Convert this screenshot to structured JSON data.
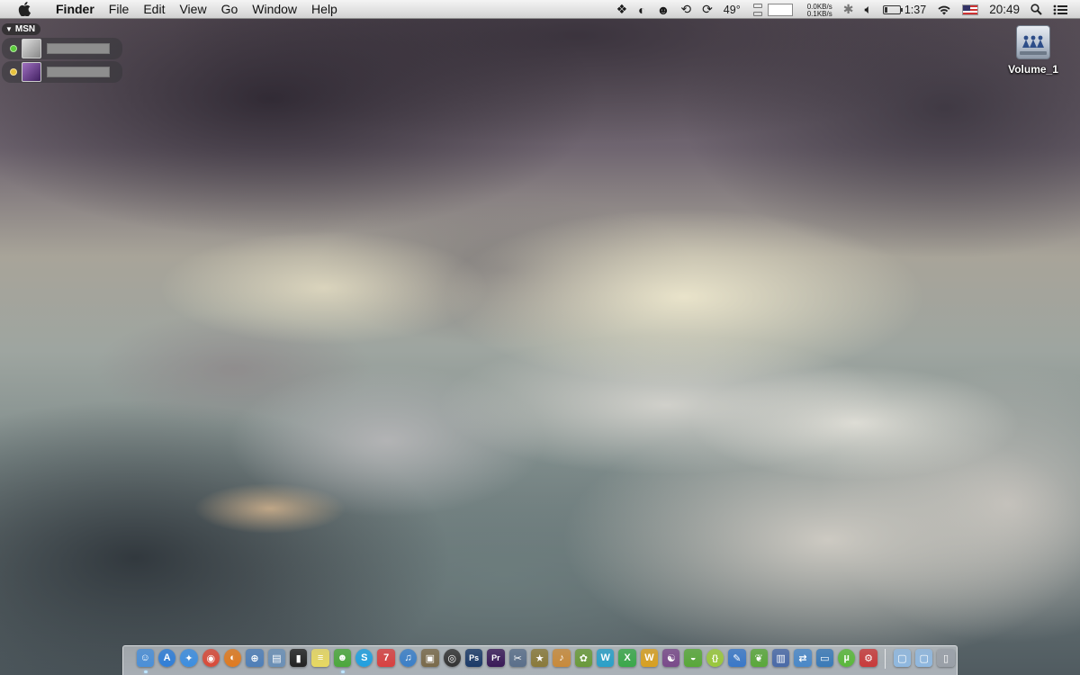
{
  "menubar": {
    "app_name": "Finder",
    "menus": [
      "File",
      "Edit",
      "View",
      "Go",
      "Window",
      "Help"
    ],
    "status": {
      "temperature": "49°",
      "net_down": "0.0KB/s",
      "net_up": "0.1KB/s",
      "battery_time": "1:37",
      "clock": "20:49"
    }
  },
  "msn": {
    "title": "MSN",
    "contacts": [
      {
        "status_color": "#5ccc3c"
      },
      {
        "status_color": "#e9c23c"
      }
    ]
  },
  "desktop": {
    "volume_label": "Volume_1"
  },
  "dock": {
    "apps": [
      {
        "icon": "finder-icon",
        "glyph": "☺",
        "color": "#4a8fd8",
        "running": true
      },
      {
        "icon": "app-store-icon",
        "glyph": "A",
        "color": "#2f7ed8",
        "running": false
      },
      {
        "icon": "safari-icon",
        "glyph": "✦",
        "color": "#3c8ee0",
        "running": false
      },
      {
        "icon": "chrome-icon",
        "glyph": "◉",
        "color": "#d94a38",
        "running": false
      },
      {
        "icon": "firefox-icon",
        "glyph": "◐",
        "color": "#e07a1e",
        "running": false
      },
      {
        "icon": "network-utility-icon",
        "glyph": "⊕",
        "color": "#4f7fb8",
        "running": false
      },
      {
        "icon": "preview-icon",
        "glyph": "▤",
        "color": "#6a8fb6",
        "running": false
      },
      {
        "icon": "terminal-icon",
        "glyph": "▮",
        "color": "#222222",
        "running": false
      },
      {
        "icon": "stickies-icon",
        "glyph": "≡",
        "color": "#e8d860",
        "running": false
      },
      {
        "icon": "adium-icon",
        "glyph": "☻",
        "color": "#4ca83c",
        "running": true
      },
      {
        "icon": "skype-icon",
        "glyph": "S",
        "color": "#1fa0e0",
        "running": false
      },
      {
        "icon": "ical-icon",
        "glyph": "7",
        "color": "#d84040",
        "running": false
      },
      {
        "icon": "itunes-icon",
        "glyph": "♫",
        "color": "#3a7fc8",
        "running": false
      },
      {
        "icon": "iphoto-icon",
        "glyph": "▣",
        "color": "#7a6a4a",
        "running": false
      },
      {
        "icon": "aperture-icon",
        "glyph": "◎",
        "color": "#333333",
        "running": false
      },
      {
        "icon": "photoshop-icon",
        "glyph": "Ps",
        "color": "#1b3a68",
        "running": false
      },
      {
        "icon": "premiere-icon",
        "glyph": "Pr",
        "color": "#3a1a58",
        "running": false
      },
      {
        "icon": "final-cut-icon",
        "glyph": "✂",
        "color": "#5a6f8a",
        "running": false
      },
      {
        "icon": "imovie-icon",
        "glyph": "★",
        "color": "#8a7a3a",
        "running": false
      },
      {
        "icon": "garageband-icon",
        "glyph": "♪",
        "color": "#c88a3a",
        "running": false
      },
      {
        "icon": "monkey-game-icon",
        "glyph": "✿",
        "color": "#6a9a3a",
        "running": false
      },
      {
        "icon": "word-icon",
        "glyph": "W",
        "color": "#2aa0c8",
        "running": false
      },
      {
        "icon": "excel-icon",
        "glyph": "X",
        "color": "#3aa84a",
        "running": false
      },
      {
        "icon": "powerpoint-icon",
        "glyph": "W",
        "color": "#d8a020",
        "running": false
      },
      {
        "icon": "widget-icon",
        "glyph": "☯",
        "color": "#7a4a8a",
        "running": false
      },
      {
        "icon": "android-icon",
        "glyph": "◒",
        "color": "#58a838",
        "running": false
      },
      {
        "icon": "coda-icon",
        "glyph": "{}",
        "color": "#9ac83a",
        "running": false
      },
      {
        "icon": "xcode-icon",
        "glyph": "✎",
        "color": "#3a78c8",
        "running": false
      },
      {
        "icon": "evernote-icon",
        "glyph": "❦",
        "color": "#5aa83a",
        "running": false
      },
      {
        "icon": "books-icon",
        "glyph": "▥",
        "color": "#4a6aa8",
        "running": false
      },
      {
        "icon": "migration-icon",
        "glyph": "⇄",
        "color": "#4a88c8",
        "running": false
      },
      {
        "icon": "screen-sharing-icon",
        "glyph": "▭",
        "color": "#3a7ab8",
        "running": false
      },
      {
        "icon": "utorrent-icon",
        "glyph": "µ",
        "color": "#5ab83a",
        "running": false
      },
      {
        "icon": "transmission-icon",
        "glyph": "⚙",
        "color": "#c83a3a",
        "running": false
      }
    ],
    "stacks": [
      {
        "icon": "downloads-folder-icon",
        "glyph": "▢",
        "color": "#8fb8e0"
      },
      {
        "icon": "documents-folder-icon",
        "glyph": "▢",
        "color": "#8fb8e0"
      },
      {
        "icon": "trash-icon",
        "glyph": "▯",
        "color": "#9aa0a8"
      }
    ]
  }
}
